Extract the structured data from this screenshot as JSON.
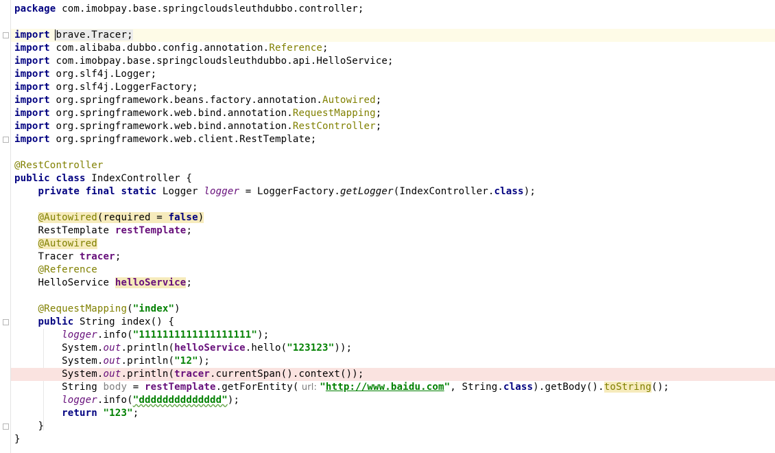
{
  "code": {
    "l1_kw": "package",
    "l1_pkg": " com.imobpay.base.springcloudsleuthdubbo.controller;",
    "l3_kw": "import",
    "l3_b": "b",
    "l3_rest": "rave.Tracer;",
    "l4_kw": "import",
    "l4_pkg": " com.alibaba.dubbo.config.annotation.",
    "l4_cls": "Reference",
    "l4_end": ";",
    "l5_kw": "import",
    "l5_pkg": " com.imobpay.base.springcloudsleuthdubbo.api.HelloService;",
    "l6_kw": "import",
    "l6_pkg": " org.slf4j.Logger;",
    "l7_kw": "import",
    "l7_pkg": " org.slf4j.LoggerFactory;",
    "l8_kw": "import",
    "l8_pkg": " org.springframework.beans.factory.annotation.",
    "l8_cls": "Autowired",
    "l8_end": ";",
    "l9_kw": "import",
    "l9_pkg": " org.springframework.web.bind.annotation.",
    "l9_cls": "RequestMapping",
    "l9_end": ";",
    "l10_kw": "import",
    "l10_pkg": " org.springframework.web.bind.annotation.",
    "l10_cls": "RestController",
    "l10_end": ";",
    "l11_kw": "import",
    "l11_pkg": " org.springframework.web.client.RestTemplate;",
    "l13_ann": "@RestController",
    "l14_kw": "public class",
    "l14_rest": " IndexController {",
    "l15_kw": "private final static",
    "l15_type": " Logger ",
    "l15_field": "logger",
    "l15_eq": " = LoggerFactory.",
    "l15_method": "getLogger",
    "l15_args": "(IndexController.",
    "l15_class_kw": "class",
    "l15_end": ");",
    "l17_ann": "@Autowired",
    "l17_open": "(required = ",
    "l17_false": "false",
    "l17_close": ")",
    "l18_type": "RestTemplate ",
    "l18_field": "restTemplate",
    "l18_end": ";",
    "l19_ann": "@Autowired",
    "l20_type": "Tracer ",
    "l20_field": "tracer",
    "l20_end": ";",
    "l21_ann": "@Reference",
    "l22_type": "HelloService ",
    "l22_field": "helloService",
    "l22_end": ";",
    "l24_ann": "@RequestMapping",
    "l24_open": "(",
    "l24_str": "\"index\"",
    "l24_close": ")",
    "l25_kw": "public",
    "l25_rest": " String index() {",
    "l26_field": "logger",
    "l26_call": ".info(",
    "l26_str": "\"1111111111111111111\"",
    "l26_end": ");",
    "l27_sys": "System.",
    "l27_out": "out",
    "l27_call": ".println(",
    "l27_field": "helloService",
    "l27_hello": ".hello(",
    "l27_str": "\"123123\"",
    "l27_end": "));",
    "l28_sys": "System.",
    "l28_out": "out",
    "l28_call": ".println(",
    "l28_str": "\"12\"",
    "l28_end": ");",
    "l29_sys": "System.",
    "l29_out": "out",
    "l29_call": ".println(",
    "l29_field": "tracer",
    "l29_end": ".currentSpan().context());",
    "l30_type": "String ",
    "l30_var": "body",
    "l30_eq": " = ",
    "l30_field": "restTemplate",
    "l30_get": ".getForEntity(",
    "l30_hint": " url: ",
    "l30_q1": "\"",
    "l30_url": "http://www.baidu.com",
    "l30_q2": "\"",
    "l30_mid": ", String.",
    "l30_class_kw": "class",
    "l30_body": ").getBody().",
    "l30_tostr": "toString",
    "l30_end": "();",
    "l31_field": "logger",
    "l31_call": ".info(",
    "l31_str": "\"dddddddddddddd\"",
    "l31_end": ");",
    "l32_kw": "return",
    "l32_str": " \"123\"",
    "l32_end": ";",
    "l33_brace": "}",
    "l34_brace": "}"
  }
}
